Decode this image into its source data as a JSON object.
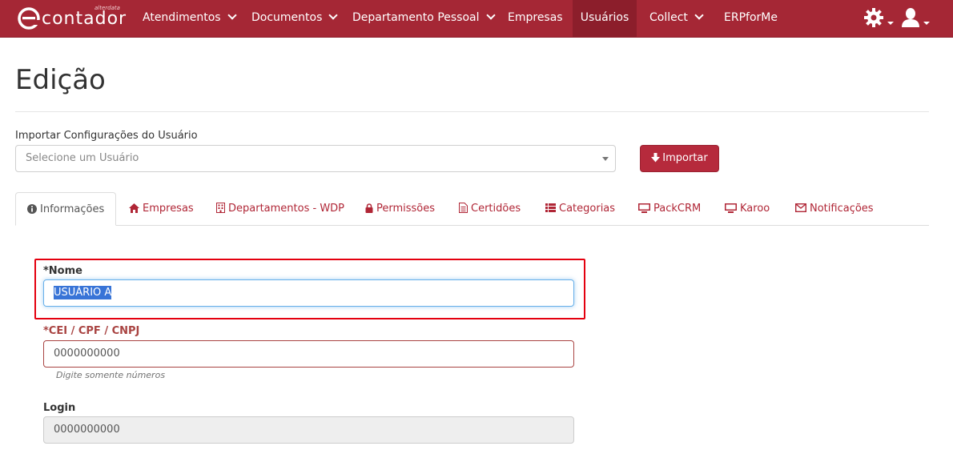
{
  "brand": {
    "name": "contador",
    "tagline": "alterdata"
  },
  "nav": {
    "items": [
      {
        "label": "Atendimentos",
        "dropdown": true
      },
      {
        "label": "Documentos",
        "dropdown": true
      },
      {
        "label": "Departamento Pessoal",
        "dropdown": true
      },
      {
        "label": "Empresas",
        "dropdown": false
      },
      {
        "label": "Usuários",
        "dropdown": false,
        "active": true
      },
      {
        "label": "Collect",
        "dropdown": true
      },
      {
        "label": "ERPforMe",
        "dropdown": false
      }
    ],
    "settings_icon": "gear-icon",
    "user_icon": "user-icon"
  },
  "page": {
    "title": "Edição"
  },
  "import": {
    "label": "Importar Configurações do Usuário",
    "placeholder": "Selecione um Usuário",
    "button_label": "Importar"
  },
  "tabs": [
    {
      "label": "Informações",
      "icon": "info-icon",
      "active": true
    },
    {
      "label": "Empresas",
      "icon": "home-icon"
    },
    {
      "label": "Departamentos - WDP",
      "icon": "building-icon"
    },
    {
      "label": "Permissões",
      "icon": "lock-icon"
    },
    {
      "label": "Certidões",
      "icon": "document-icon"
    },
    {
      "label": "Categorias",
      "icon": "list-icon"
    },
    {
      "label": "PackCRM",
      "icon": "monitor-icon"
    },
    {
      "label": "Karoo",
      "icon": "monitor-icon"
    },
    {
      "label": "Notificações",
      "icon": "envelope-icon"
    }
  ],
  "form": {
    "nome": {
      "label": "*Nome",
      "value": "USUÁRIO A"
    },
    "documento": {
      "label": "*CEI / CPF / CNPJ",
      "value": "0000000000",
      "help": "Digite somente números"
    },
    "login": {
      "label": "Login",
      "value": "0000000000"
    }
  },
  "colors": {
    "navbar": "#a52735",
    "accent": "#b62a3c",
    "link": "#b02636",
    "error_label": "#a94442",
    "highlight": "#e4000f"
  }
}
